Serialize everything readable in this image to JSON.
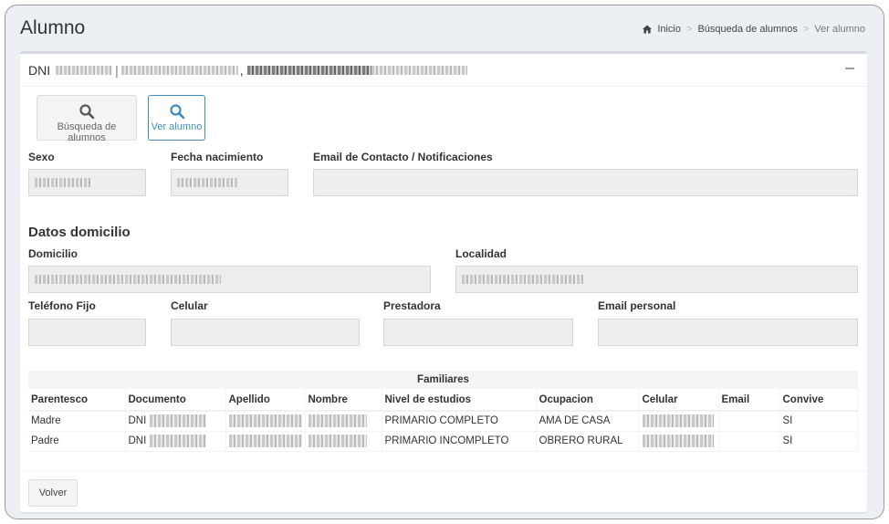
{
  "header": {
    "title": "Alumno",
    "breadcrumb": {
      "home": "Inicio",
      "search": "Búsqueda de alumnos",
      "current": "Ver alumno"
    }
  },
  "student_box": {
    "doc_prefix": "DNI",
    "separator": "|",
    "comma": ","
  },
  "actions": {
    "search_label": "Búsqueda de alumnos",
    "view_label": "Ver alumno"
  },
  "fields": {
    "sexo_label": "Sexo",
    "fecha_label": "Fecha nacimiento",
    "email_contacto_label": "Email de Contacto / Notificaciones",
    "email_contacto_value": ""
  },
  "domicilio": {
    "section_title": "Datos domicilio",
    "domicilio_label": "Domicilio",
    "localidad_label": "Localidad",
    "telefono_label": "Teléfono Fijo",
    "telefono_value": "",
    "celular_label": "Celular",
    "celular_value": "",
    "prestadora_label": "Prestadora",
    "prestadora_value": "",
    "email_personal_label": "Email personal",
    "email_personal_value": ""
  },
  "familiares": {
    "caption": "Familiares",
    "columns": [
      "Parentesco",
      "Documento",
      "Apellido",
      "Nombre",
      "Nivel de estudios",
      "Ocupacion",
      "Celular",
      "Email",
      "Convive"
    ],
    "rows": [
      {
        "parentesco": "Madre",
        "documento": "DNI",
        "nivel": "PRIMARIO COMPLETO",
        "ocupacion": "AMA DE CASA",
        "email": "",
        "convive": "SI"
      },
      {
        "parentesco": "Padre",
        "documento": "DNI",
        "nivel": "PRIMARIO INCOMPLETO",
        "ocupacion": "OBRERO RURAL",
        "email": "",
        "convive": "SI"
      }
    ]
  },
  "footer": {
    "back_label": "Volver"
  },
  "colors": {
    "accent": "#3c8dbc",
    "background": "#ecf0f5",
    "field_bg": "#eeeeee"
  },
  "icons": [
    "home-icon",
    "search-icon",
    "minus-icon"
  ]
}
